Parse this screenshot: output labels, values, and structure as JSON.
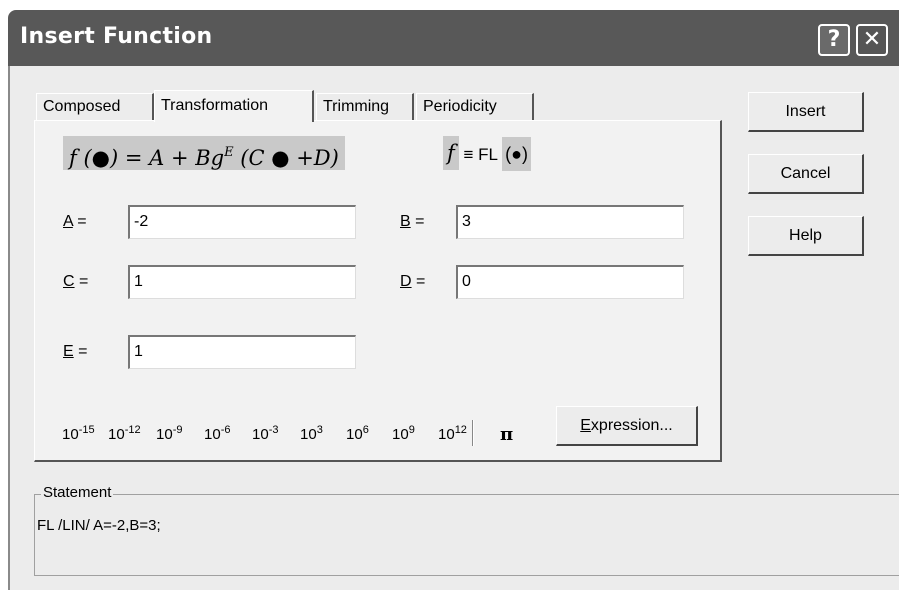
{
  "window": {
    "title": "Insert Function",
    "help_button": "?",
    "close_button": "✕"
  },
  "tabs": [
    "Composed",
    "Transformation",
    "Trimming",
    "Periodicity"
  ],
  "active_tab": "Transformation",
  "formula": {
    "lhs": "f (●) = A + Bg",
    "exponent": "E",
    "rhs": " (C ● +D)",
    "definition_f": "f",
    "definition_eq": "≡ FL",
    "definition_arg": "(●)"
  },
  "params": {
    "A": {
      "label": "A",
      "rest": " =",
      "value": "-2"
    },
    "B": {
      "label": "B",
      "rest": " =",
      "value": "3"
    },
    "C": {
      "label": "C",
      "rest": " =",
      "value": "1"
    },
    "D": {
      "label": "D",
      "rest": " =",
      "value": "0"
    },
    "E": {
      "label": "E",
      "rest": " =",
      "value": "1"
    }
  },
  "powers": [
    {
      "base": "10",
      "exp": "-15"
    },
    {
      "base": "10",
      "exp": "-12"
    },
    {
      "base": "10",
      "exp": "-9"
    },
    {
      "base": "10",
      "exp": "-6"
    },
    {
      "base": "10",
      "exp": "-3"
    },
    {
      "base": "10",
      "exp": "3"
    },
    {
      "base": "10",
      "exp": "6"
    },
    {
      "base": "10",
      "exp": "9"
    },
    {
      "base": "10",
      "exp": "12"
    }
  ],
  "pi": "π",
  "expression_button": {
    "accel": "E",
    "rest": "xpression..."
  },
  "buttons": {
    "insert": "Insert",
    "cancel": "Cancel",
    "help": "Help"
  },
  "statement": {
    "label": "Statement",
    "text": "FL /LIN/ A=-2,B=3;"
  }
}
